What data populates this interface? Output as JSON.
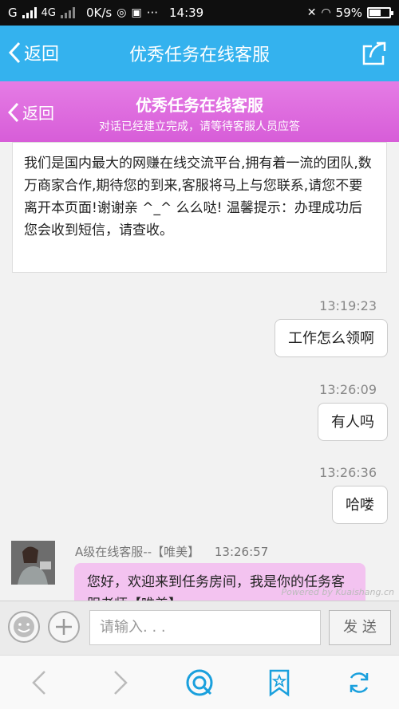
{
  "status_bar": {
    "carrier": "G",
    "network": "4G",
    "speed": "0K/s",
    "time": "14:39",
    "battery": "59%",
    "battery_level": 0.59
  },
  "header": {
    "back_label": "返回",
    "title": "优秀任务在线客服"
  },
  "service_header": {
    "back_label": "返回",
    "title": "优秀任务在线客服",
    "subtitle": "对话已经建立完成，请等待客服人员应答"
  },
  "chat": {
    "notice": "我们是国内最大的网赚在线交流平台,拥有着一流的团队,数万商家合作,期待您的到来,客服将马上与您联系,请您不要离开本页面!谢谢亲 ^_^ 么么哒! 温馨提示：办理成功后您会收到短信，请查收。",
    "messages": [
      {
        "time": "13:19:23",
        "text": "工作怎么领啊"
      },
      {
        "time": "13:26:09",
        "text": "有人吗"
      },
      {
        "time": "13:26:36",
        "text": "哈喽"
      }
    ],
    "agent": {
      "name": "A级在线客服--【唯美】",
      "time": "13:26:57",
      "text": "您好，欢迎来到任务房间，我是你的任务客服老师【唯美】"
    },
    "watermark": "Powered by Kuaishang.cn"
  },
  "input_bar": {
    "placeholder": "请输入. . .",
    "send_label": "发 送"
  },
  "colors": {
    "app_header": "#34b2ee",
    "service_header": "#d75dd8",
    "agent_bubble": "#f3c3f0",
    "accent_blue": "#1aa0dd"
  }
}
